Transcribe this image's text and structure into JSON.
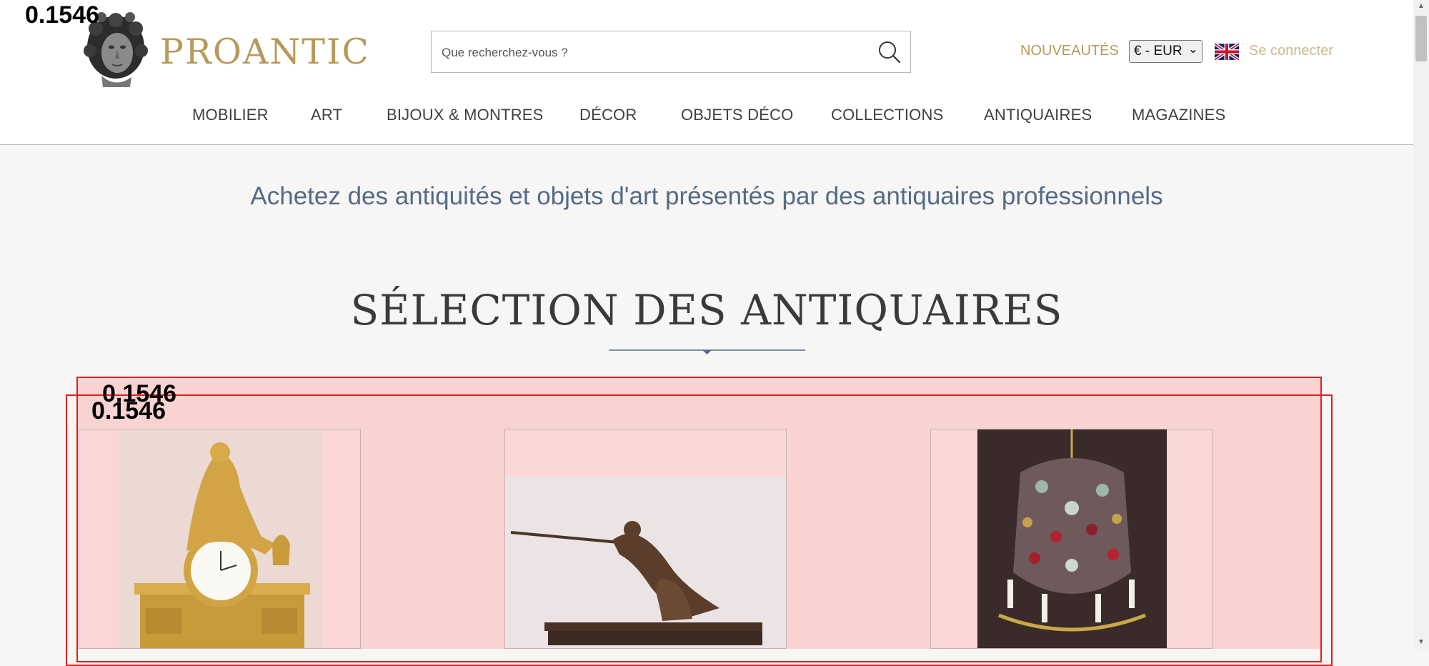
{
  "overlay": {
    "score_label": "0.1546"
  },
  "header": {
    "logo_text": "PROANTIC",
    "search_placeholder": "Que recherchez-vous ?",
    "new_label": "NOUVEAUTÉS",
    "currency_value": "€ - EUR",
    "language_icon": "uk-flag-icon",
    "signin_label": "Se connecter"
  },
  "nav": {
    "items": [
      "MOBILIER",
      "ART",
      "BIJOUX & MONTRES",
      "DÉCOR",
      "OBJETS DÉCO",
      "COLLECTIONS",
      "ANTIQUAIRES",
      "MAGAZINES"
    ]
  },
  "main": {
    "tagline": "Achetez des antiquités et objets d'art présentés par des antiquaires professionnels",
    "section_title": "SÉLECTION DES ANTIQUAIRES"
  },
  "colors": {
    "gold": "#b79a5b",
    "slate": "#536b87",
    "overlay_red": "#e01f1f",
    "highlight_pink": "#f9d2d2"
  }
}
